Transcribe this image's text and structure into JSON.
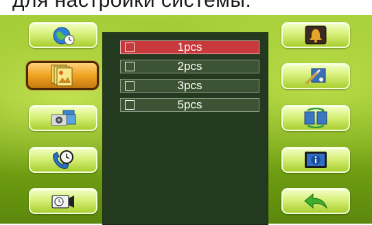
{
  "header": {
    "text": "для настройки системы."
  },
  "menu": {
    "options": [
      {
        "label": "1pcs",
        "selected": true
      },
      {
        "label": "2pcs",
        "selected": false
      },
      {
        "label": "3pcs",
        "selected": false
      },
      {
        "label": "5pcs",
        "selected": false
      }
    ]
  },
  "left_buttons": [
    {
      "icon": "globe-clock-icon",
      "active": false
    },
    {
      "icon": "photo-stack-icon",
      "active": true
    },
    {
      "icon": "camera-photos-icon",
      "active": false
    },
    {
      "icon": "phone-clock-icon",
      "active": false
    },
    {
      "icon": "camera-timer-icon",
      "active": false
    }
  ],
  "right_buttons": [
    {
      "icon": "bell-icon",
      "active": false
    },
    {
      "icon": "display-settings-icon",
      "active": false
    },
    {
      "icon": "transfer-3d-icon",
      "active": false
    },
    {
      "icon": "info-icon",
      "active": false
    },
    {
      "icon": "back-arrow-icon",
      "active": false
    }
  ],
  "colors": {
    "selected_option": "#c8393c",
    "option": "#3d5434",
    "panel": "#243a20",
    "active_button": "#f0a323"
  }
}
